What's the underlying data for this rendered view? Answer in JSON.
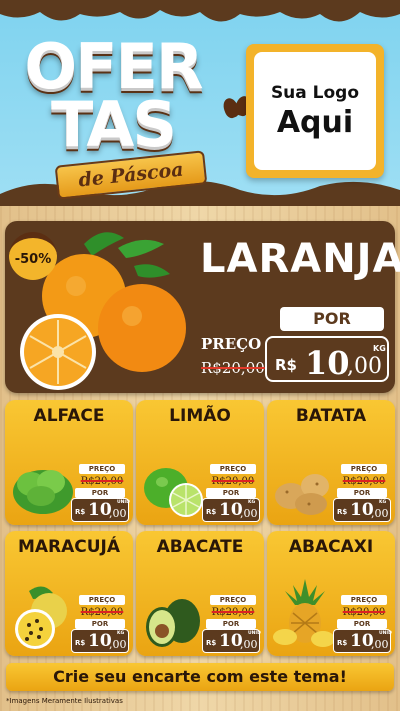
{
  "header": {
    "title_line1": "OFER",
    "title_line2": "TAS",
    "ribbon": "de Páscoa",
    "logo_line1": "Sua Logo",
    "logo_line2": "Aqui"
  },
  "colors": {
    "sky": "#8fd9f2",
    "chocolate": "#5c3a1e",
    "yellow": "#f3b52b",
    "white": "#ffffff"
  },
  "featured": {
    "discount": "-50%",
    "name": "LARANJA",
    "preco_label": "PREÇO",
    "old_price": "R$20,00",
    "por_label": "POR",
    "currency": "R$",
    "price_main": "10",
    "price_cents": ",00",
    "unit": "KG"
  },
  "products": [
    {
      "name": "ALFACE",
      "preco_label": "PREÇO",
      "old_price": "R$20,00",
      "por_label": "POR",
      "currency": "R$",
      "price_main": "10",
      "price_cents": ",00",
      "unit": "UNID",
      "icon": "lettuce-icon"
    },
    {
      "name": "LIMÃO",
      "preco_label": "PREÇO",
      "old_price": "R$20,00",
      "por_label": "POR",
      "currency": "R$",
      "price_main": "10",
      "price_cents": ",00",
      "unit": "KG",
      "icon": "lime-icon"
    },
    {
      "name": "BATATA",
      "preco_label": "PREÇO",
      "old_price": "R$20,00",
      "por_label": "POR",
      "currency": "R$",
      "price_main": "10",
      "price_cents": ",00",
      "unit": "KG",
      "icon": "potato-icon"
    },
    {
      "name": "MARACUJÁ",
      "preco_label": "PREÇO",
      "old_price": "R$20,00",
      "por_label": "POR",
      "currency": "R$",
      "price_main": "10",
      "price_cents": ",00",
      "unit": "KG",
      "icon": "passion-fruit-icon"
    },
    {
      "name": "ABACATE",
      "preco_label": "PREÇO",
      "old_price": "R$20,00",
      "por_label": "POR",
      "currency": "R$",
      "price_main": "10",
      "price_cents": ",00",
      "unit": "UNID",
      "icon": "avocado-icon"
    },
    {
      "name": "ABACAXI",
      "preco_label": "PREÇO",
      "old_price": "R$20,00",
      "por_label": "POR",
      "currency": "R$",
      "price_main": "10",
      "price_cents": ",00",
      "unit": "UNID",
      "icon": "pineapple-icon"
    }
  ],
  "banner": "Crie seu encarte com este tema!",
  "disclaimer": "*Imagens Meramente Ilustrativas"
}
